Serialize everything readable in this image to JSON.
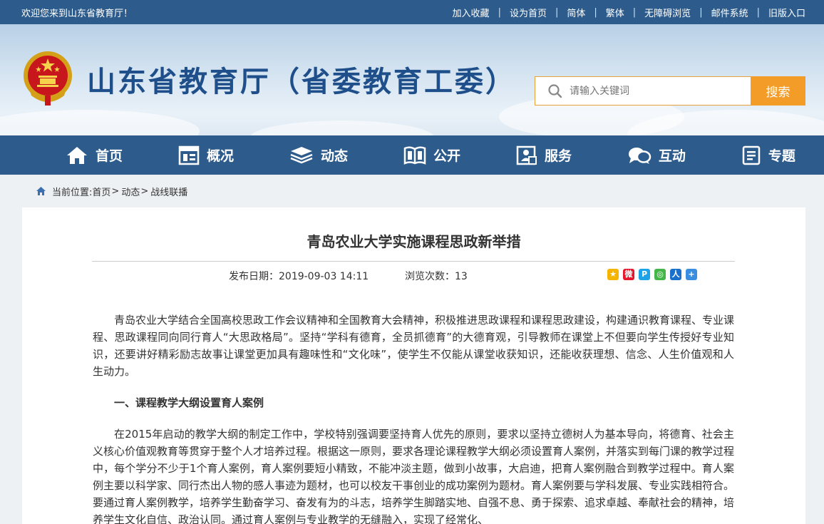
{
  "topbar": {
    "welcome": "欢迎您来到山东省教育厅！",
    "links": [
      "加入收藏",
      "设为首页",
      "简体",
      "繁体",
      "无障碍浏览",
      "邮件系统",
      "旧版入口"
    ],
    "separator": "|"
  },
  "header": {
    "site_title": "山东省教育厅（省委教育工委）",
    "search_placeholder": "请输入关键词",
    "search_button": "搜索"
  },
  "nav": {
    "items": [
      {
        "label": "首页",
        "icon": "home-icon"
      },
      {
        "label": "概况",
        "icon": "overview-icon"
      },
      {
        "label": "动态",
        "icon": "news-stack-icon"
      },
      {
        "label": "公开",
        "icon": "open-book-icon"
      },
      {
        "label": "服务",
        "icon": "service-icon"
      },
      {
        "label": "互动",
        "icon": "chat-bubble-icon"
      },
      {
        "label": "专题",
        "icon": "document-icon"
      }
    ]
  },
  "breadcrumb": {
    "prefix": "当前位置:",
    "items": [
      "首页",
      "动态",
      "战线联播"
    ],
    "arrow": ">"
  },
  "article": {
    "title": "青岛农业大学实施课程思政新举措",
    "publish_date": "发布日期：2019-09-03 14:11",
    "views": "浏览次数：13",
    "share_icons": [
      "qzone-share-icon",
      "weibo-share-icon",
      "tencent-share-icon",
      "wechat-share-icon",
      "renren-share-icon",
      "more-share-icon"
    ],
    "paragraph1": "青岛农业大学结合全国高校思政工作会议精神和全国教育大会精神，积极推进思政课程和课程思政建设，构建通识教育课程、专业课程、思政课程同向同行育人“大思政格局”。坚持“学科有德育，全员抓德育”的大德育观，引导教师在课堂上不但要向学生传授好专业知识，还要讲好精彩励志故事让课堂更加具有趣味性和“文化味”，使学生不仅能从课堂收获知识，还能收获理想、信念、人生价值观和人生动力。",
    "heading1": "一、课程教学大纲设置育人案例",
    "paragraph2": "在2015年启动的教学大纲的制定工作中，学校特别强调要坚持育人优先的原则，要求以坚持立德树人为基本导向，将德育、社会主义核心价值观教育等贯穿于整个人才培养过程。根据这一原则，要求各理论课程教学大纲必须设置育人案例，并落实到每门课的教学过程中，每个学分不少于1个育人案例，育人案例要短小精致，不能冲淡主题，做到小故事，大启迪，把育人案例融合到教学过程中。育人案例主要以科学家、同行杰出人物的感人事迹为题材，也可以校友干事创业的成功案例为题材。育人案例要与学科发展、专业实践相符合。要通过育人案例教学，培养学生勤奋学习、奋发有为的斗志，培养学生脚踏实地、自强不息、勇于探索、追求卓越、奉献社会的精神，培养学生文化自信、政治认同。通过育人案例与专业教学的无缝融入，实现了经常化、"
  },
  "colors": {
    "primary": "#2d5c8c",
    "title_blue": "#1f4f8a",
    "search_orange": "#f39c28"
  }
}
